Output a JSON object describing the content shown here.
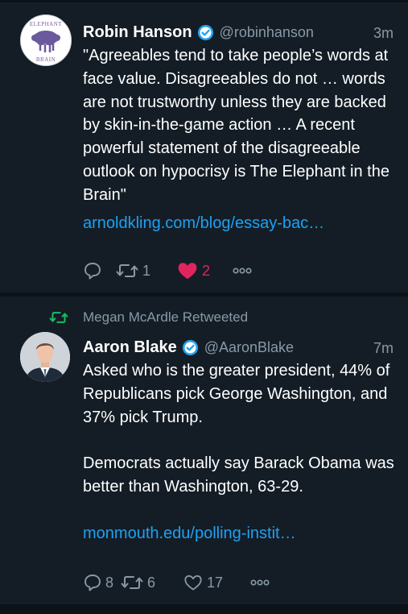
{
  "tweets": [
    {
      "name": "Robin Hanson",
      "handle": "@robinhanson",
      "time": "3m",
      "avatar_logo_text": [
        "ELEPHANT",
        "BRAIN"
      ],
      "body": [
        "\"Agreeables tend to take people’s words at face value. Disagreeables do not … words are not trustworthy unless they are backed by skin-in-the-game action … A recent powerful statement of the disagreeable outlook on hypocrisy is The Elephant in the Brain\""
      ],
      "link": "arnoldkling.com/blog/essay-bac…",
      "replies": "",
      "retweets": "1",
      "likes": "2",
      "liked": true
    },
    {
      "retweeted_by": "Megan McArdle Retweeted",
      "name": "Aaron Blake",
      "handle": "@AaronBlake",
      "time": "7m",
      "body": [
        "Asked who is the greater president, 44% of Republicans pick George Washington, and 37% pick Trump.",
        "Democrats actually say Barack Obama was better than Washington, 63-29."
      ],
      "link": "monmouth.edu/polling-instit…",
      "replies": "8",
      "retweets": "6",
      "likes": "17",
      "liked": false
    }
  ],
  "colors": {
    "background": "#141d26",
    "link": "#1da1f2",
    "muted": "#8899a6",
    "like": "#e0245e",
    "retweet_context": "#17bf63"
  }
}
